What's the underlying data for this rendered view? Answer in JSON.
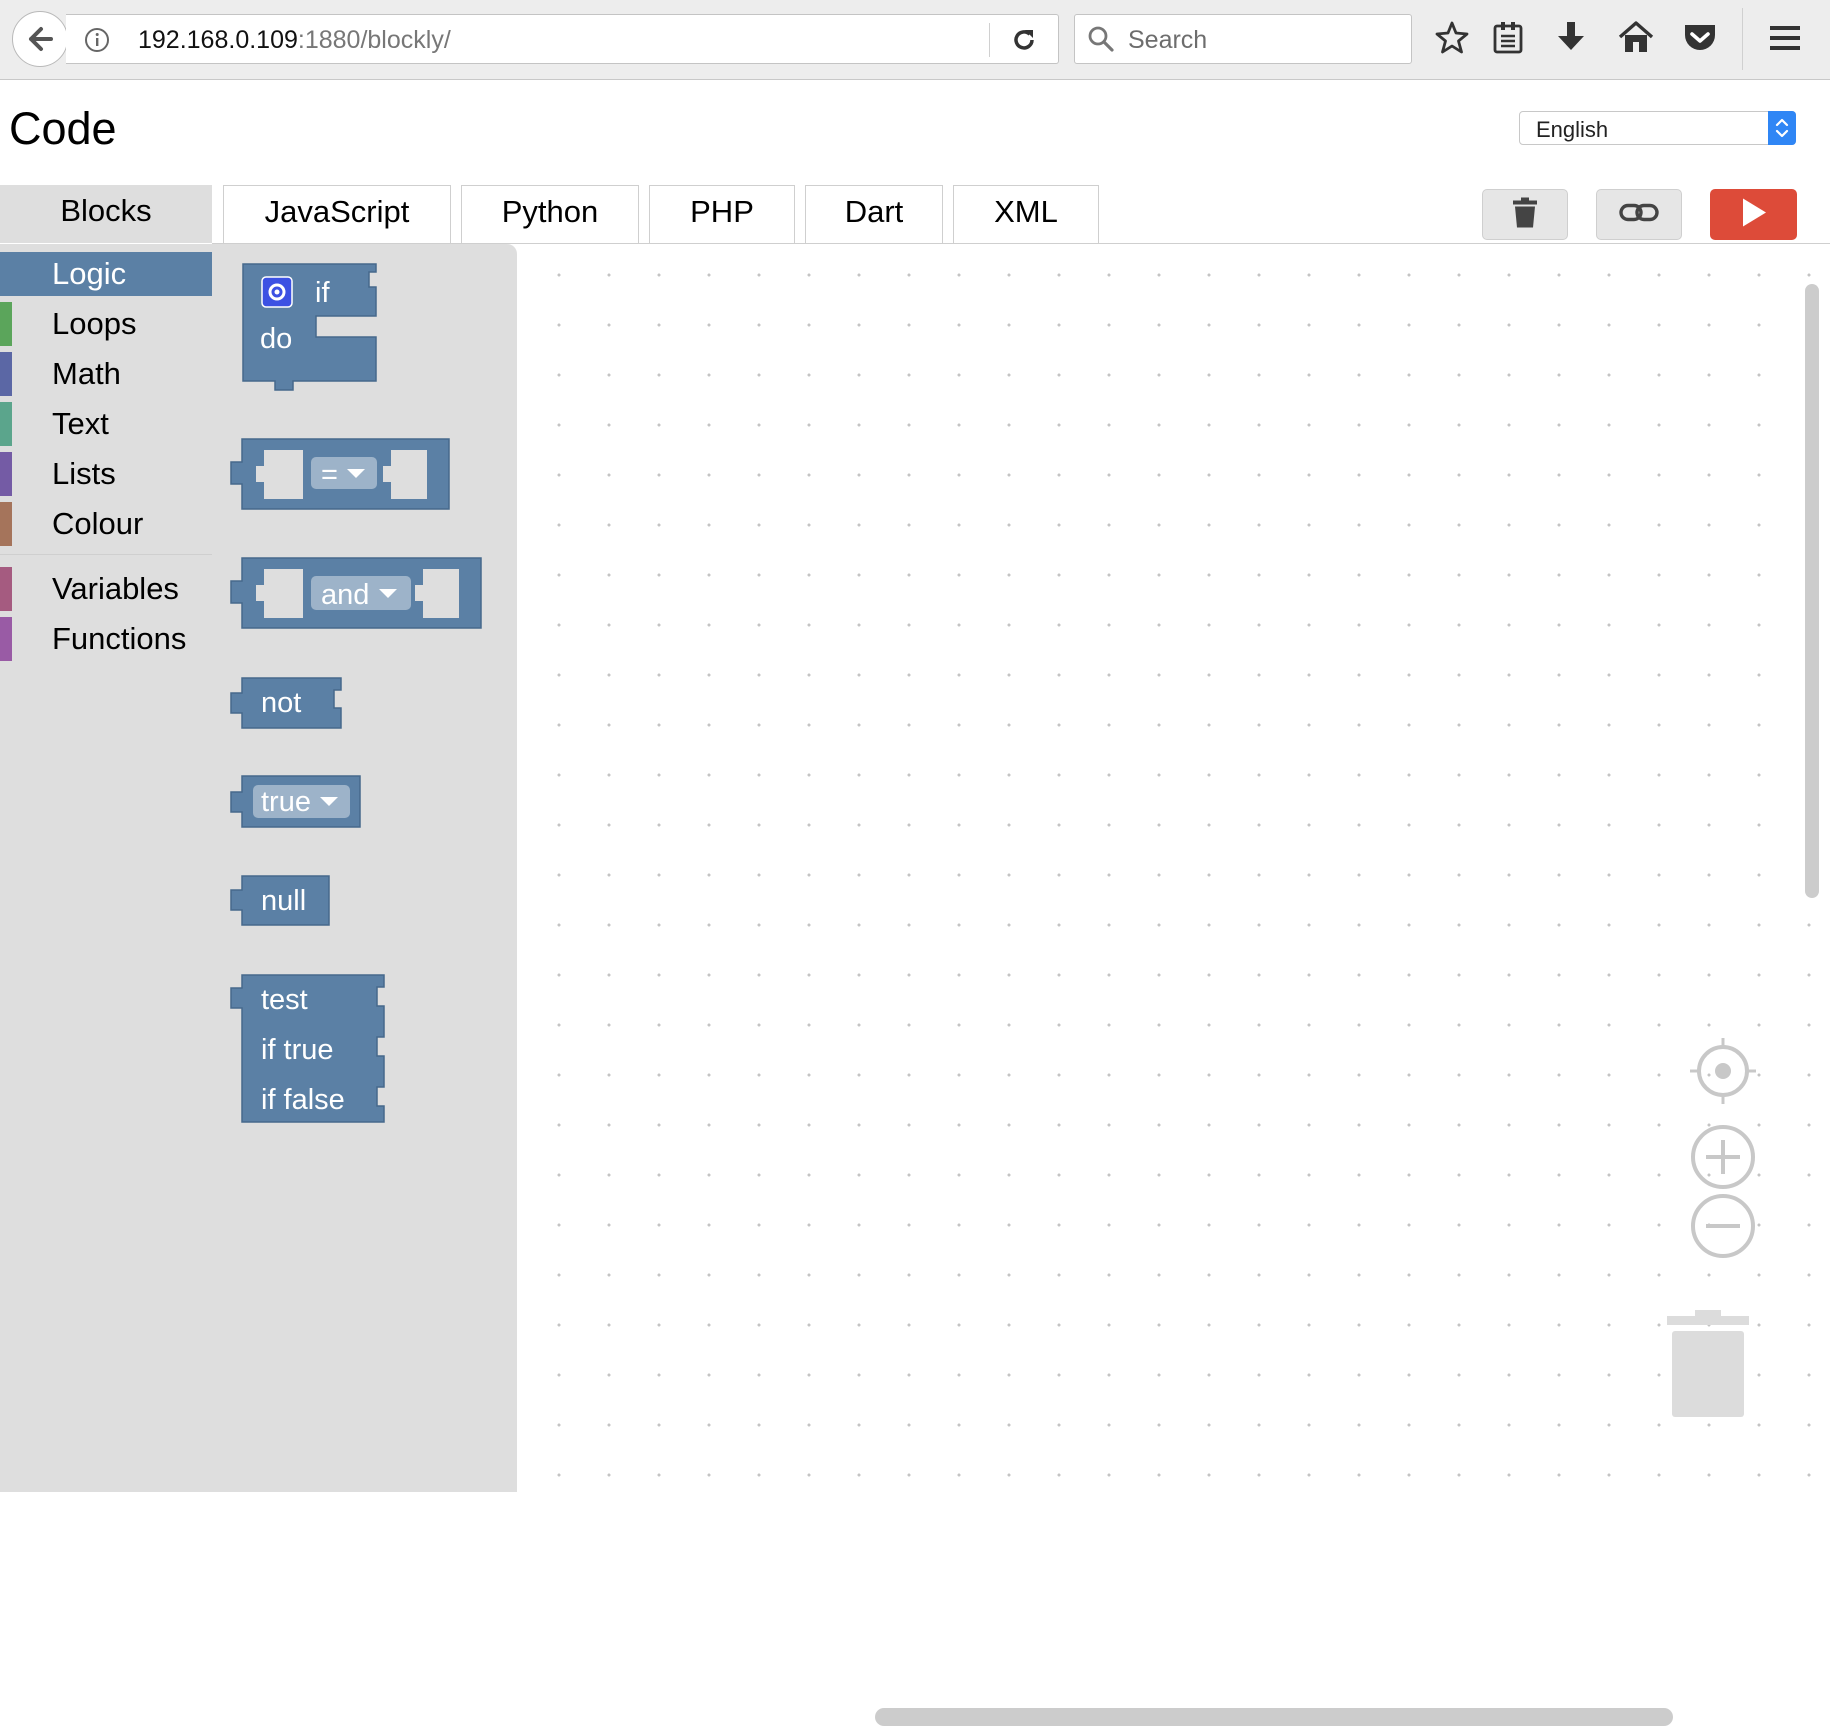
{
  "browser": {
    "url_host": "192.168.0.109",
    "url_rest": ":1880/blockly/",
    "search_placeholder": "Search",
    "icons": [
      "back-icon",
      "info-icon",
      "reload-icon",
      "search-icon",
      "bookmark-star-icon",
      "reading-list-icon",
      "download-icon",
      "home-icon",
      "pocket-icon",
      "menu-icon"
    ]
  },
  "header": {
    "title": "Code",
    "language": "English"
  },
  "tabs": [
    "Blocks",
    "JavaScript",
    "Python",
    "PHP",
    "Dart",
    "XML"
  ],
  "actions": {
    "icons": [
      "trash-icon",
      "link-icon",
      "play-icon"
    ],
    "run_color": "#dd4b39"
  },
  "toolbox": {
    "categories": [
      {
        "label": "Logic",
        "color": "#5b80a5"
      },
      {
        "label": "Loops",
        "color": "#5ba55b"
      },
      {
        "label": "Math",
        "color": "#5b67a5"
      },
      {
        "label": "Text",
        "color": "#5ba58c"
      },
      {
        "label": "Lists",
        "color": "#745ba5"
      },
      {
        "label": "Colour",
        "color": "#a5745b"
      },
      {
        "label": "Variables",
        "color": "#a55b80"
      },
      {
        "label": "Functions",
        "color": "#995ba5"
      }
    ]
  },
  "flyout": {
    "block_color": "#5b80a5",
    "if_block": {
      "if_label": "if",
      "do_label": "do"
    },
    "compare_block": {
      "operator": "="
    },
    "logic_op_block": {
      "operator": "and"
    },
    "negate_block": {
      "label": "not"
    },
    "boolean_block": {
      "value": "true"
    },
    "null_block": {
      "label": "null"
    },
    "ternary_block": {
      "test_label": "test",
      "then_label": "if true",
      "else_label": "if false"
    }
  },
  "workspace": {
    "icons": [
      "recenter-icon",
      "zoom-in-icon",
      "zoom-out-icon",
      "workspace-trash-icon"
    ]
  }
}
